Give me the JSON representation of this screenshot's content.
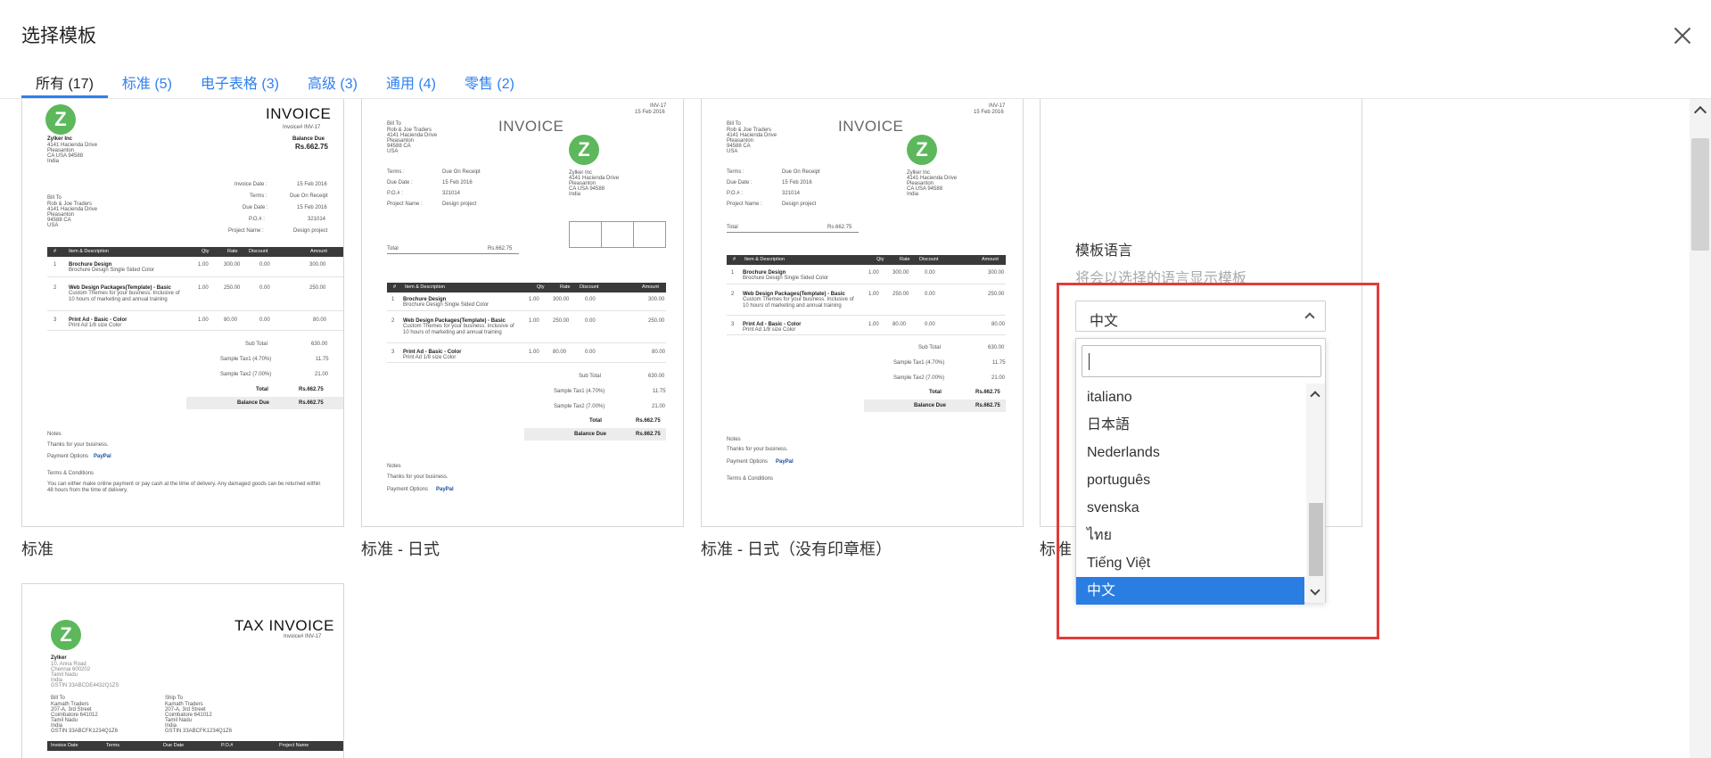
{
  "dialog": {
    "title": "选择模板"
  },
  "tabs": [
    {
      "label": "所有 (17)"
    },
    {
      "label": "标准 (5)"
    },
    {
      "label": "电子表格 (3)"
    },
    {
      "label": "高级 (3)"
    },
    {
      "label": "通用 (4)"
    },
    {
      "label": "零售 (2)"
    }
  ],
  "templates": [
    {
      "name": "标准"
    },
    {
      "name": "标准 - 日式"
    },
    {
      "name": "标准 - 日式（没有印章框）"
    },
    {
      "name": "标准"
    }
  ],
  "invoice": {
    "title": "INVOICE",
    "tax_title": "TAX INVOICE",
    "logo_letter": "Z",
    "number": "INV-17",
    "invoice_hash": "Invoice# INV-17",
    "date": "15 Feb 2016",
    "company": "Zylker Inc",
    "company_addr": [
      "4141 Hacienda Drive",
      "Pleasanton",
      "CA USA 94588",
      "India"
    ],
    "balance_due_label": "Balance Due",
    "balance": "Rs.662.75",
    "bill_to_label": "Bill To",
    "bill_to": [
      "Rob & Joe Traders",
      "4141 Hacienda Drive",
      "Pleasanton",
      "94588 CA",
      "USA"
    ],
    "meta_labels": [
      "Invoice Date :",
      "Terms :",
      "Due Date :",
      "P.O.# :",
      "Project Name :"
    ],
    "meta_values": [
      "15 Feb 2016",
      "Due On Receipt",
      "15 Feb 2016",
      "321014",
      "Design project"
    ],
    "jp_meta_labels": [
      "Terms :",
      "Due Date :",
      "P.O.# :",
      "Project Name :"
    ],
    "jp_meta_values": [
      "Due On Receipt",
      "15 Feb 2016",
      "321014",
      "Design project"
    ],
    "total_label": "Total",
    "table_headers": [
      "#",
      "Item & Description",
      "Qty",
      "Rate",
      "Discount",
      "Amount"
    ],
    "items": [
      {
        "no": "1",
        "name": "Brochure Design",
        "desc": "Brochure Design Single Sided Color",
        "qty": "1.00",
        "rate": "300.00",
        "disc": "0.00",
        "amount": "300.00"
      },
      {
        "no": "2",
        "name": "Web Design Packages(Template) - Basic",
        "desc": "Custom Themes for your business. Inclusive of 10 hours of marketing and annual training",
        "qty": "1.00",
        "rate": "250.00",
        "disc": "0.00",
        "amount": "250.00"
      },
      {
        "no": "3",
        "name": "Print Ad - Basic - Color",
        "desc": "Print Ad 1/8 size Color",
        "qty": "1.00",
        "rate": "80.00",
        "disc": "0.00",
        "amount": "80.00"
      }
    ],
    "summary_labels": [
      "Sub Total",
      "Sample Tax1 (4.70%)",
      "Sample Tax2 (7.00%)",
      "Total",
      "Balance Due"
    ],
    "summary_values": [
      "630.00",
      "11.75",
      "21.00",
      "Rs.662.75",
      "Rs.662.75"
    ],
    "notes_label": "Notes",
    "notes": "Thanks for your business.",
    "payment_label": "Payment Options",
    "paypal": "PayPal",
    "terms_label": "Terms & Conditions",
    "terms_text": "You can either make online payment or pay cash at the time of delivery. Any damaged goods can be returned within 48 hours from the time of delivery.",
    "tax_company": "Zylker",
    "tax_company_addr": [
      "10, Anna Road",
      "Chennai 600202",
      "Tamil Nadu",
      "India",
      "GSTIN 33ABCDE4432Q1ZS"
    ],
    "ship_to_label": "Ship To",
    "tax_party": [
      "Kamath Traders",
      "207-A, 3rd Street",
      "Coimbatore 641012",
      "Tamil Nadu",
      "India",
      "GSTIN 33ABCFK1234Q1Z6"
    ],
    "tax_table_headers": [
      "Invoice Date",
      "Terms",
      "Due Date",
      "P.O.#",
      "Project Name"
    ]
  },
  "language_panel": {
    "title": "模板语言",
    "subtitle": "将会以选择的语言显示模板",
    "selected": "中文",
    "search_placeholder": "",
    "options": [
      "italiano",
      "日本語",
      "Nederlands",
      "português",
      "svenska",
      "ไทย",
      "Tiếng Việt",
      "中文"
    ],
    "highlight_color": "#e23b3b",
    "selected_color": "#2a7de1"
  },
  "colors": {
    "accent": "#2f80ed",
    "logo": "#5db85c"
  }
}
